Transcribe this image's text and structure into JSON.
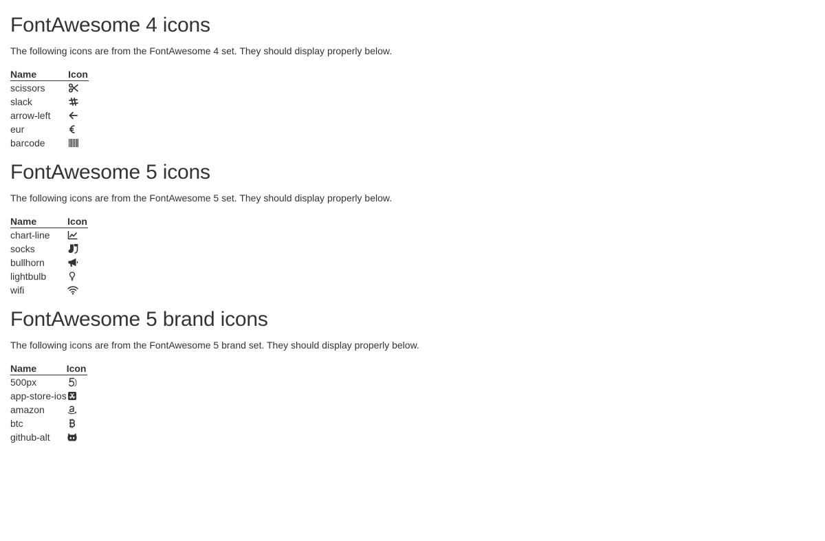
{
  "sections": [
    {
      "title": "FontAwesome 4 icons",
      "description": "The following icons are from the FontAwesome 4 set. They should display properly below.",
      "header_name": "Name",
      "header_icon": "Icon",
      "rows": [
        {
          "name": "scissors",
          "icon": "scissors-icon"
        },
        {
          "name": "slack",
          "icon": "slack-icon"
        },
        {
          "name": "arrow-left",
          "icon": "arrow-left-icon"
        },
        {
          "name": "eur",
          "icon": "euro-icon"
        },
        {
          "name": "barcode",
          "icon": "barcode-icon"
        }
      ]
    },
    {
      "title": "FontAwesome 5 icons",
      "description": "The following icons are from the FontAwesome 5 set. They should display properly below.",
      "header_name": "Name",
      "header_icon": "Icon",
      "rows": [
        {
          "name": "chart-line",
          "icon": "chart-line-icon"
        },
        {
          "name": "socks",
          "icon": "socks-icon"
        },
        {
          "name": "bullhorn",
          "icon": "bullhorn-icon"
        },
        {
          "name": "lightbulb",
          "icon": "lightbulb-icon"
        },
        {
          "name": "wifi",
          "icon": "wifi-icon"
        }
      ]
    },
    {
      "title": "FontAwesome 5 brand icons",
      "description": "The following icons are from the FontAwesome 5 brand set. They should display properly below.",
      "header_name": "Name",
      "header_icon": "Icon",
      "rows": [
        {
          "name": "500px",
          "icon": "500px-icon"
        },
        {
          "name": "app-store-ios",
          "icon": "app-store-ios-icon"
        },
        {
          "name": "amazon",
          "icon": "amazon-icon"
        },
        {
          "name": "btc",
          "icon": "btc-icon"
        },
        {
          "name": "github-alt",
          "icon": "github-alt-icon"
        }
      ]
    }
  ]
}
